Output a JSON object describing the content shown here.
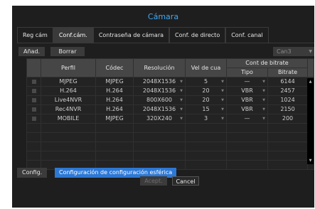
{
  "window": {
    "title": "Cámara"
  },
  "tabs": [
    {
      "label": "Reg cám",
      "active": false
    },
    {
      "label": "Conf.cám.",
      "active": true
    },
    {
      "label": "Contraseña de cámara",
      "active": false
    },
    {
      "label": "Conf. de directo",
      "active": false
    },
    {
      "label": "Conf. canal",
      "active": false
    }
  ],
  "toolbar": {
    "add_label": "Añad.",
    "delete_label": "Borrar",
    "channel_value": "Can3"
  },
  "table": {
    "headers": {
      "profile": "Perfil",
      "codec": "Códec",
      "resolution": "Resolución",
      "fps": "Vel de cua",
      "bitrate_group": "Cont de bitrate",
      "bitrate_type": "Tipo",
      "bitrate": "Bitrate"
    },
    "rows": [
      {
        "profile": "MJPEG",
        "codec": "MJPEG",
        "resolution": "2048X1536",
        "fps": "5",
        "type": "—",
        "bitrate": "6144"
      },
      {
        "profile": "H.264",
        "codec": "H.264",
        "resolution": "2048X1536",
        "fps": "20",
        "type": "VBR",
        "bitrate": "2457"
      },
      {
        "profile": "Live4NVR",
        "codec": "H.264",
        "resolution": "800X600",
        "fps": "20",
        "type": "VBR",
        "bitrate": "1024"
      },
      {
        "profile": "Rec4NVR",
        "codec": "H.264",
        "resolution": "2048X1536",
        "fps": "15",
        "type": "VBR",
        "bitrate": "2150"
      },
      {
        "profile": "MOBILE",
        "codec": "MJPEG",
        "resolution": "320X240",
        "fps": "3",
        "type": "—",
        "bitrate": "200"
      }
    ]
  },
  "bottom": {
    "config_label": "Config.",
    "spherical_label": "Configuración de configuración esférica"
  },
  "footer": {
    "accept_label": "Acept.",
    "cancel_label": "Cancel"
  },
  "colors": {
    "accent": "#3fa9f5",
    "button_blue": "#2d78d4",
    "background": "#1e1e1e"
  }
}
